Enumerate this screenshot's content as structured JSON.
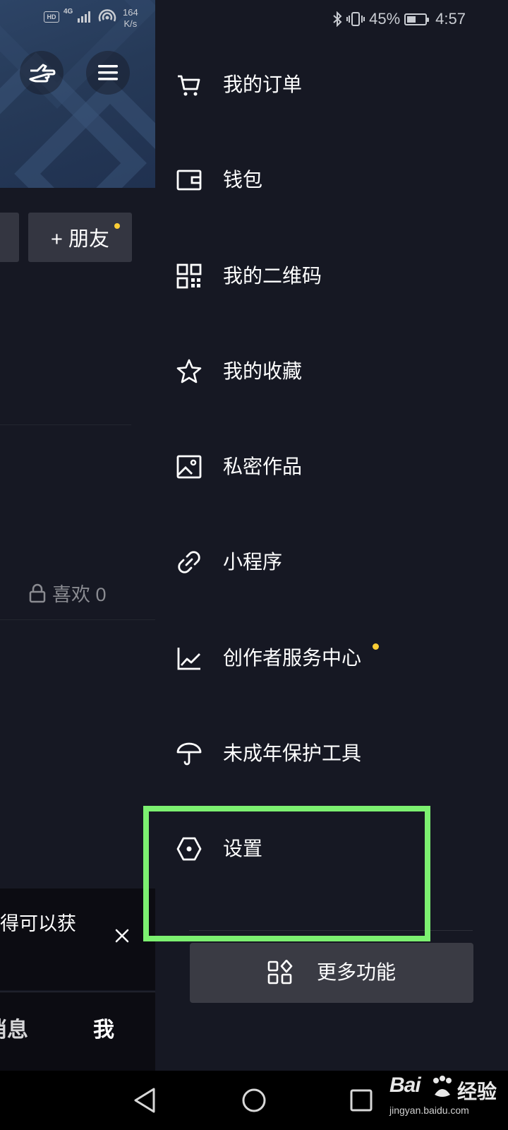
{
  "status_bar": {
    "left": {
      "hd": "HD",
      "network": "4G",
      "speed_value": "164",
      "speed_unit": "K/s"
    },
    "right": {
      "battery": "45%",
      "time": "4:57"
    }
  },
  "profile": {
    "add_friends_label": "+ 朋友",
    "likes_tab": "喜欢 0",
    "notice_text": "得可以获",
    "bottom_nav": {
      "messages": "消息",
      "me": "我"
    }
  },
  "drawer": {
    "items": [
      {
        "label": "我的订单",
        "icon": "cart-icon"
      },
      {
        "label": "钱包",
        "icon": "wallet-icon"
      },
      {
        "label": "我的二维码",
        "icon": "qrcode-icon"
      },
      {
        "label": "我的收藏",
        "icon": "star-icon"
      },
      {
        "label": "私密作品",
        "icon": "image-icon"
      },
      {
        "label": "小程序",
        "icon": "link-icon"
      },
      {
        "label": "创作者服务中心",
        "icon": "chart-icon",
        "badge": true
      },
      {
        "label": "未成年保护工具",
        "icon": "umbrella-icon"
      },
      {
        "label": "设置",
        "icon": "settings-hexagon-icon"
      }
    ],
    "more_label": "更多功能"
  },
  "highlight": {
    "target": "设置",
    "color": "#7cf070"
  },
  "colors": {
    "background": "#161823",
    "badge": "#facd35",
    "button": "#3a3b44"
  },
  "watermark": {
    "brand": "Bai",
    "suffix": "经验",
    "url": "jingyan.baidu.com"
  }
}
